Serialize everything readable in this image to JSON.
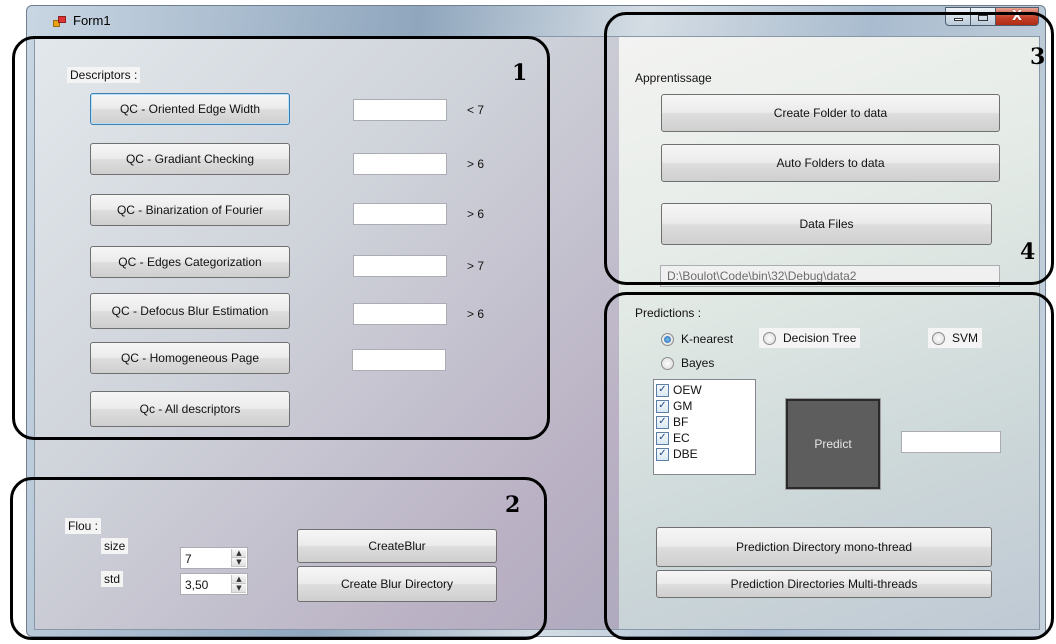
{
  "window": {
    "title": "Form1",
    "controls": {
      "minimize": "–",
      "maximize": "□",
      "close": "X"
    }
  },
  "icons": {
    "app": "form-app-icon",
    "minimize": "minimize-icon",
    "maximize": "maximize-icon",
    "close": "close-icon"
  },
  "annotations": [
    "1",
    "2",
    "3",
    "4"
  ],
  "descriptors": {
    "label": "Descriptors :",
    "rows": [
      {
        "button": "QC - Oriented Edge Width",
        "value": "",
        "threshold": "< 7"
      },
      {
        "button": "QC - Gradiant Checking",
        "value": "",
        "threshold": "> 6"
      },
      {
        "button": "QC - Binarization of Fourier",
        "value": "",
        "threshold": "> 6"
      },
      {
        "button": "QC - Edges Categorization",
        "value": "",
        "threshold": "> 7"
      },
      {
        "button": "QC - Defocus Blur Estimation",
        "value": "",
        "threshold": "> 6"
      },
      {
        "button": "QC - Homogeneous Page",
        "value": "",
        "threshold": ""
      }
    ],
    "all_button": "Qc - All descriptors"
  },
  "flou": {
    "label": "Flou :",
    "size_label": "size",
    "size_value": "7",
    "std_label": "std",
    "std_value": "3,50",
    "create_blur": "CreateBlur",
    "create_blur_dir": "Create Blur Directory"
  },
  "apprentissage": {
    "label": "Apprentissage",
    "create_folder": "Create Folder to data",
    "auto_folders": "Auto Folders to data",
    "data_files": "Data Files",
    "path": "D:\\Boulot\\Code\\bin\\32\\Debug\\data2"
  },
  "predictions": {
    "label": "Predictions :",
    "radios": [
      {
        "label": "K-nearest",
        "checked": true
      },
      {
        "label": "Decision Tree",
        "checked": false
      },
      {
        "label": "SVM",
        "checked": false
      },
      {
        "label": "Bayes",
        "checked": false
      }
    ],
    "features": [
      {
        "label": "OEW",
        "checked": true
      },
      {
        "label": "GM",
        "checked": true
      },
      {
        "label": "BF",
        "checked": true
      },
      {
        "label": "EC",
        "checked": true
      },
      {
        "label": "DBE",
        "checked": true
      }
    ],
    "check_glyph": "✓",
    "predict": "Predict",
    "result": "",
    "mono_thread": "Prediction Directory mono-thread",
    "multi_threads": "Prediction Directories Multi-threads"
  }
}
